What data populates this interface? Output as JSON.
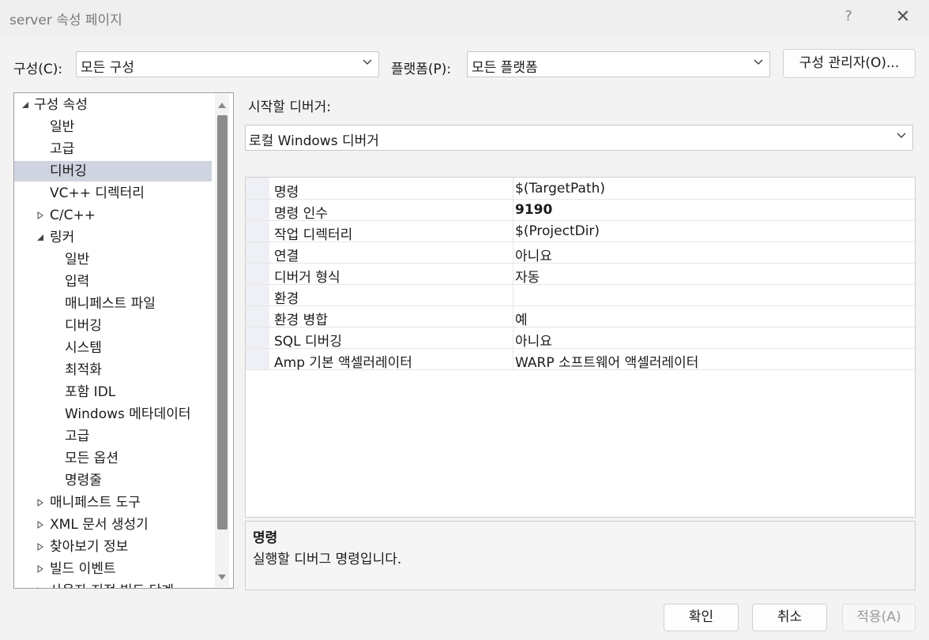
{
  "window": {
    "title": "server 속성 페이지",
    "help_glyph": "?",
    "close_glyph": "✕"
  },
  "config": {
    "label": "구성(C):",
    "value": "모든 구성"
  },
  "platform": {
    "label": "플랫폼(P):",
    "value": "모든 플랫폼"
  },
  "config_manager_label": "구성 관리자(O)...",
  "tree": [
    {
      "label": "구성 속성",
      "expander": "open"
    },
    {
      "label": "일반"
    },
    {
      "label": "고급"
    },
    {
      "label": "디버깅",
      "selected": true
    },
    {
      "label": "VC++ 디렉터리"
    },
    {
      "label": "C/C++",
      "expander": "closed"
    },
    {
      "label": "링커",
      "expander": "open"
    },
    {
      "label": "일반"
    },
    {
      "label": "입력"
    },
    {
      "label": "매니페스트 파일"
    },
    {
      "label": "디버깅"
    },
    {
      "label": "시스템"
    },
    {
      "label": "최적화"
    },
    {
      "label": "포함 IDL"
    },
    {
      "label": "Windows 메타데이터"
    },
    {
      "label": "고급"
    },
    {
      "label": "모든 옵션"
    },
    {
      "label": "명령줄"
    },
    {
      "label": "매니페스트 도구",
      "expander": "closed"
    },
    {
      "label": "XML 문서 생성기",
      "expander": "closed"
    },
    {
      "label": "찾아보기 정보",
      "expander": "closed"
    },
    {
      "label": "빌드 이벤트",
      "expander": "closed"
    },
    {
      "label": "사용자 지정 빌드 단계",
      "expander": "closed"
    }
  ],
  "debugger": {
    "label": "시작할 디버거:",
    "value": "로컬 Windows 디버거"
  },
  "properties": [
    {
      "name": "명령",
      "value": "$(TargetPath)"
    },
    {
      "name": "명령 인수",
      "value": "9190",
      "bold": true
    },
    {
      "name": "작업 디렉터리",
      "value": "$(ProjectDir)"
    },
    {
      "name": "연결",
      "value": "아니요"
    },
    {
      "name": "디버거 형식",
      "value": "자동"
    },
    {
      "name": "환경",
      "value": ""
    },
    {
      "name": "환경 병합",
      "value": "예"
    },
    {
      "name": "SQL 디버깅",
      "value": "아니요"
    },
    {
      "name": "Amp 기본 액셀러레이터",
      "value": "WARP 소프트웨어 액셀러레이터"
    }
  ],
  "description": {
    "title": "명령",
    "text": "실행할 디버그 명령입니다."
  },
  "buttons": {
    "ok": "확인",
    "cancel": "취소",
    "apply": "적용(A)"
  }
}
